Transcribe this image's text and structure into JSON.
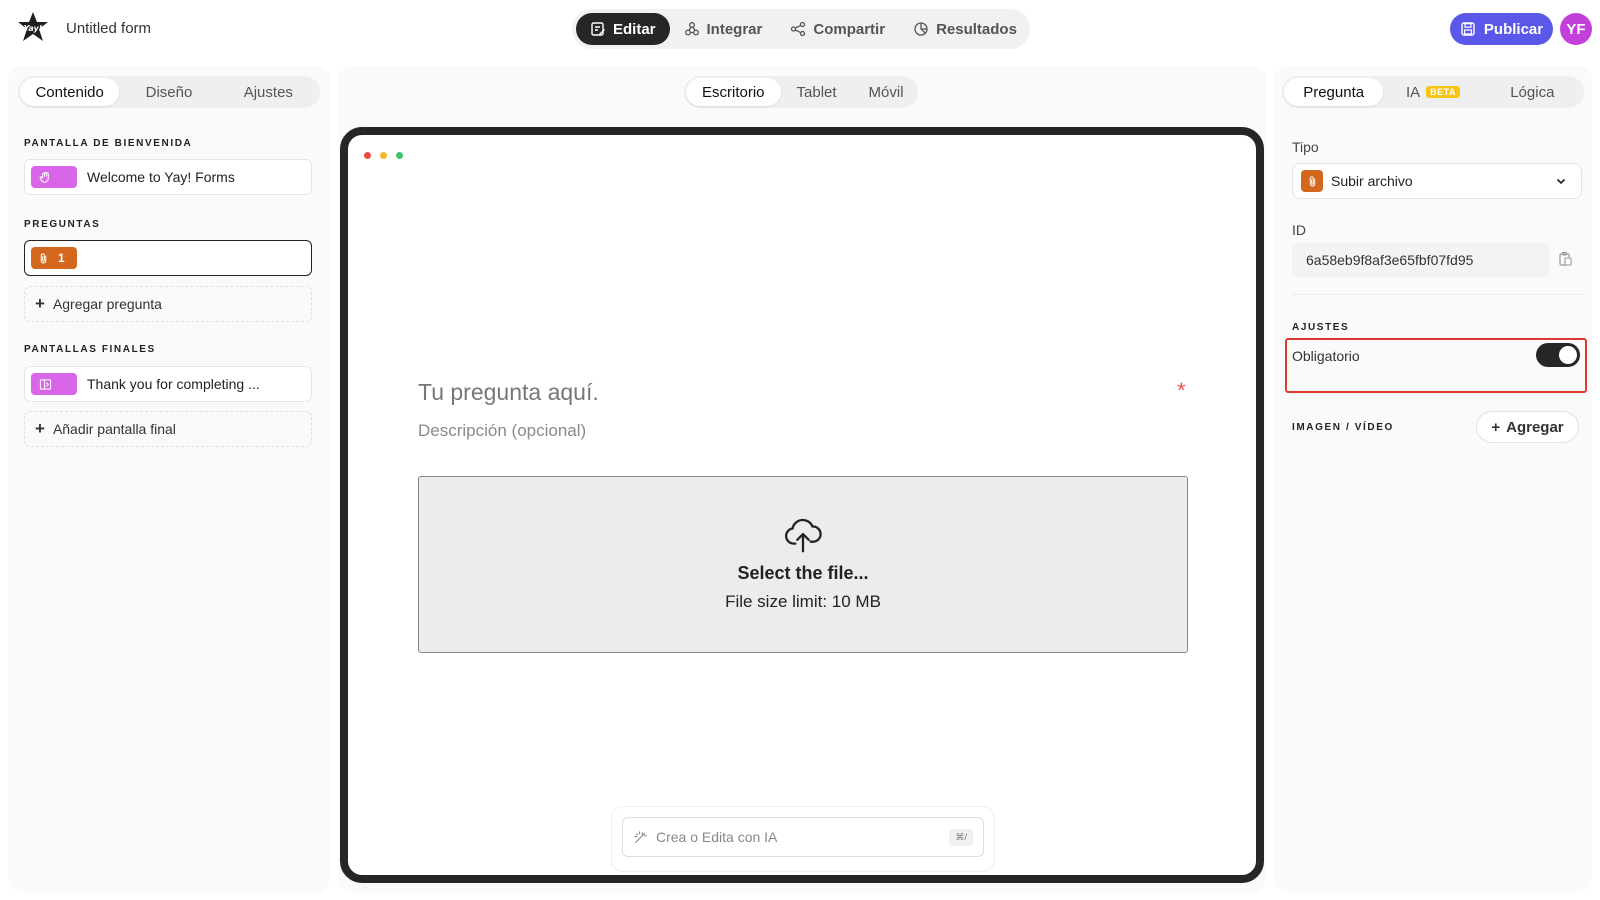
{
  "app": {
    "form_title": "Untitled form"
  },
  "topnav": {
    "items": [
      {
        "label": "Editar",
        "icon": "edit-icon",
        "active": true
      },
      {
        "label": "Integrar",
        "icon": "integrate-icon",
        "active": false
      },
      {
        "label": "Compartir",
        "icon": "share-icon",
        "active": false
      },
      {
        "label": "Resultados",
        "icon": "results-icon",
        "active": false
      }
    ],
    "publish_label": "Publicar",
    "avatar_initials": "YF"
  },
  "left_panel": {
    "tabs": [
      {
        "label": "Contenido",
        "active": true
      },
      {
        "label": "Diseño",
        "active": false
      },
      {
        "label": "Ajustes",
        "active": false
      }
    ],
    "welcome_section_label": "PANTALLA DE BIENVENIDA",
    "welcome_item": "Welcome to Yay! Forms",
    "questions_section_label": "PREGUNTAS",
    "question_item_number": "1",
    "add_question_label": "Agregar pregunta",
    "endings_section_label": "PANTALLAS FINALES",
    "ending_item": "Thank you for completing ...",
    "add_ending_label": "Añadir pantalla final"
  },
  "center": {
    "device_tabs": [
      {
        "label": "Escritorio",
        "active": true
      },
      {
        "label": "Tablet",
        "active": false
      },
      {
        "label": "Móvil",
        "active": false
      }
    ],
    "question_placeholder": "Tu pregunta aquí.",
    "description_placeholder": "Descripción (opcional)",
    "required_marker": "*",
    "upload_title": "Select the file...",
    "upload_limit": "File size limit: 10 MB",
    "ai_placeholder": "Crea o Edita con IA",
    "ai_shortcut": "⌘/"
  },
  "right_panel": {
    "tabs": [
      {
        "label": "Pregunta",
        "active": true
      },
      {
        "label": "IA",
        "active": false,
        "badge": "BETA"
      },
      {
        "label": "Lógica",
        "active": false
      }
    ],
    "type_label": "Tipo",
    "type_value": "Subir archivo",
    "id_label": "ID",
    "id_value": "6a58eb9f8af3e65fbf07fd95",
    "settings_section_label": "AJUSTES",
    "required_label": "Obligatorio",
    "required_on": true,
    "media_section_label": "IMAGEN / VÍDEO",
    "add_media_label": "Agregar"
  },
  "colors": {
    "accent": "#5b57e8",
    "avatar": "#c33fd9",
    "file_type": "#d2671d",
    "screen_badge": "#d966e8",
    "highlight": "#dc3b2f",
    "required": "#e55353",
    "window_dots": [
      "#e9503f",
      "#f2b72c",
      "#42c46b"
    ]
  }
}
